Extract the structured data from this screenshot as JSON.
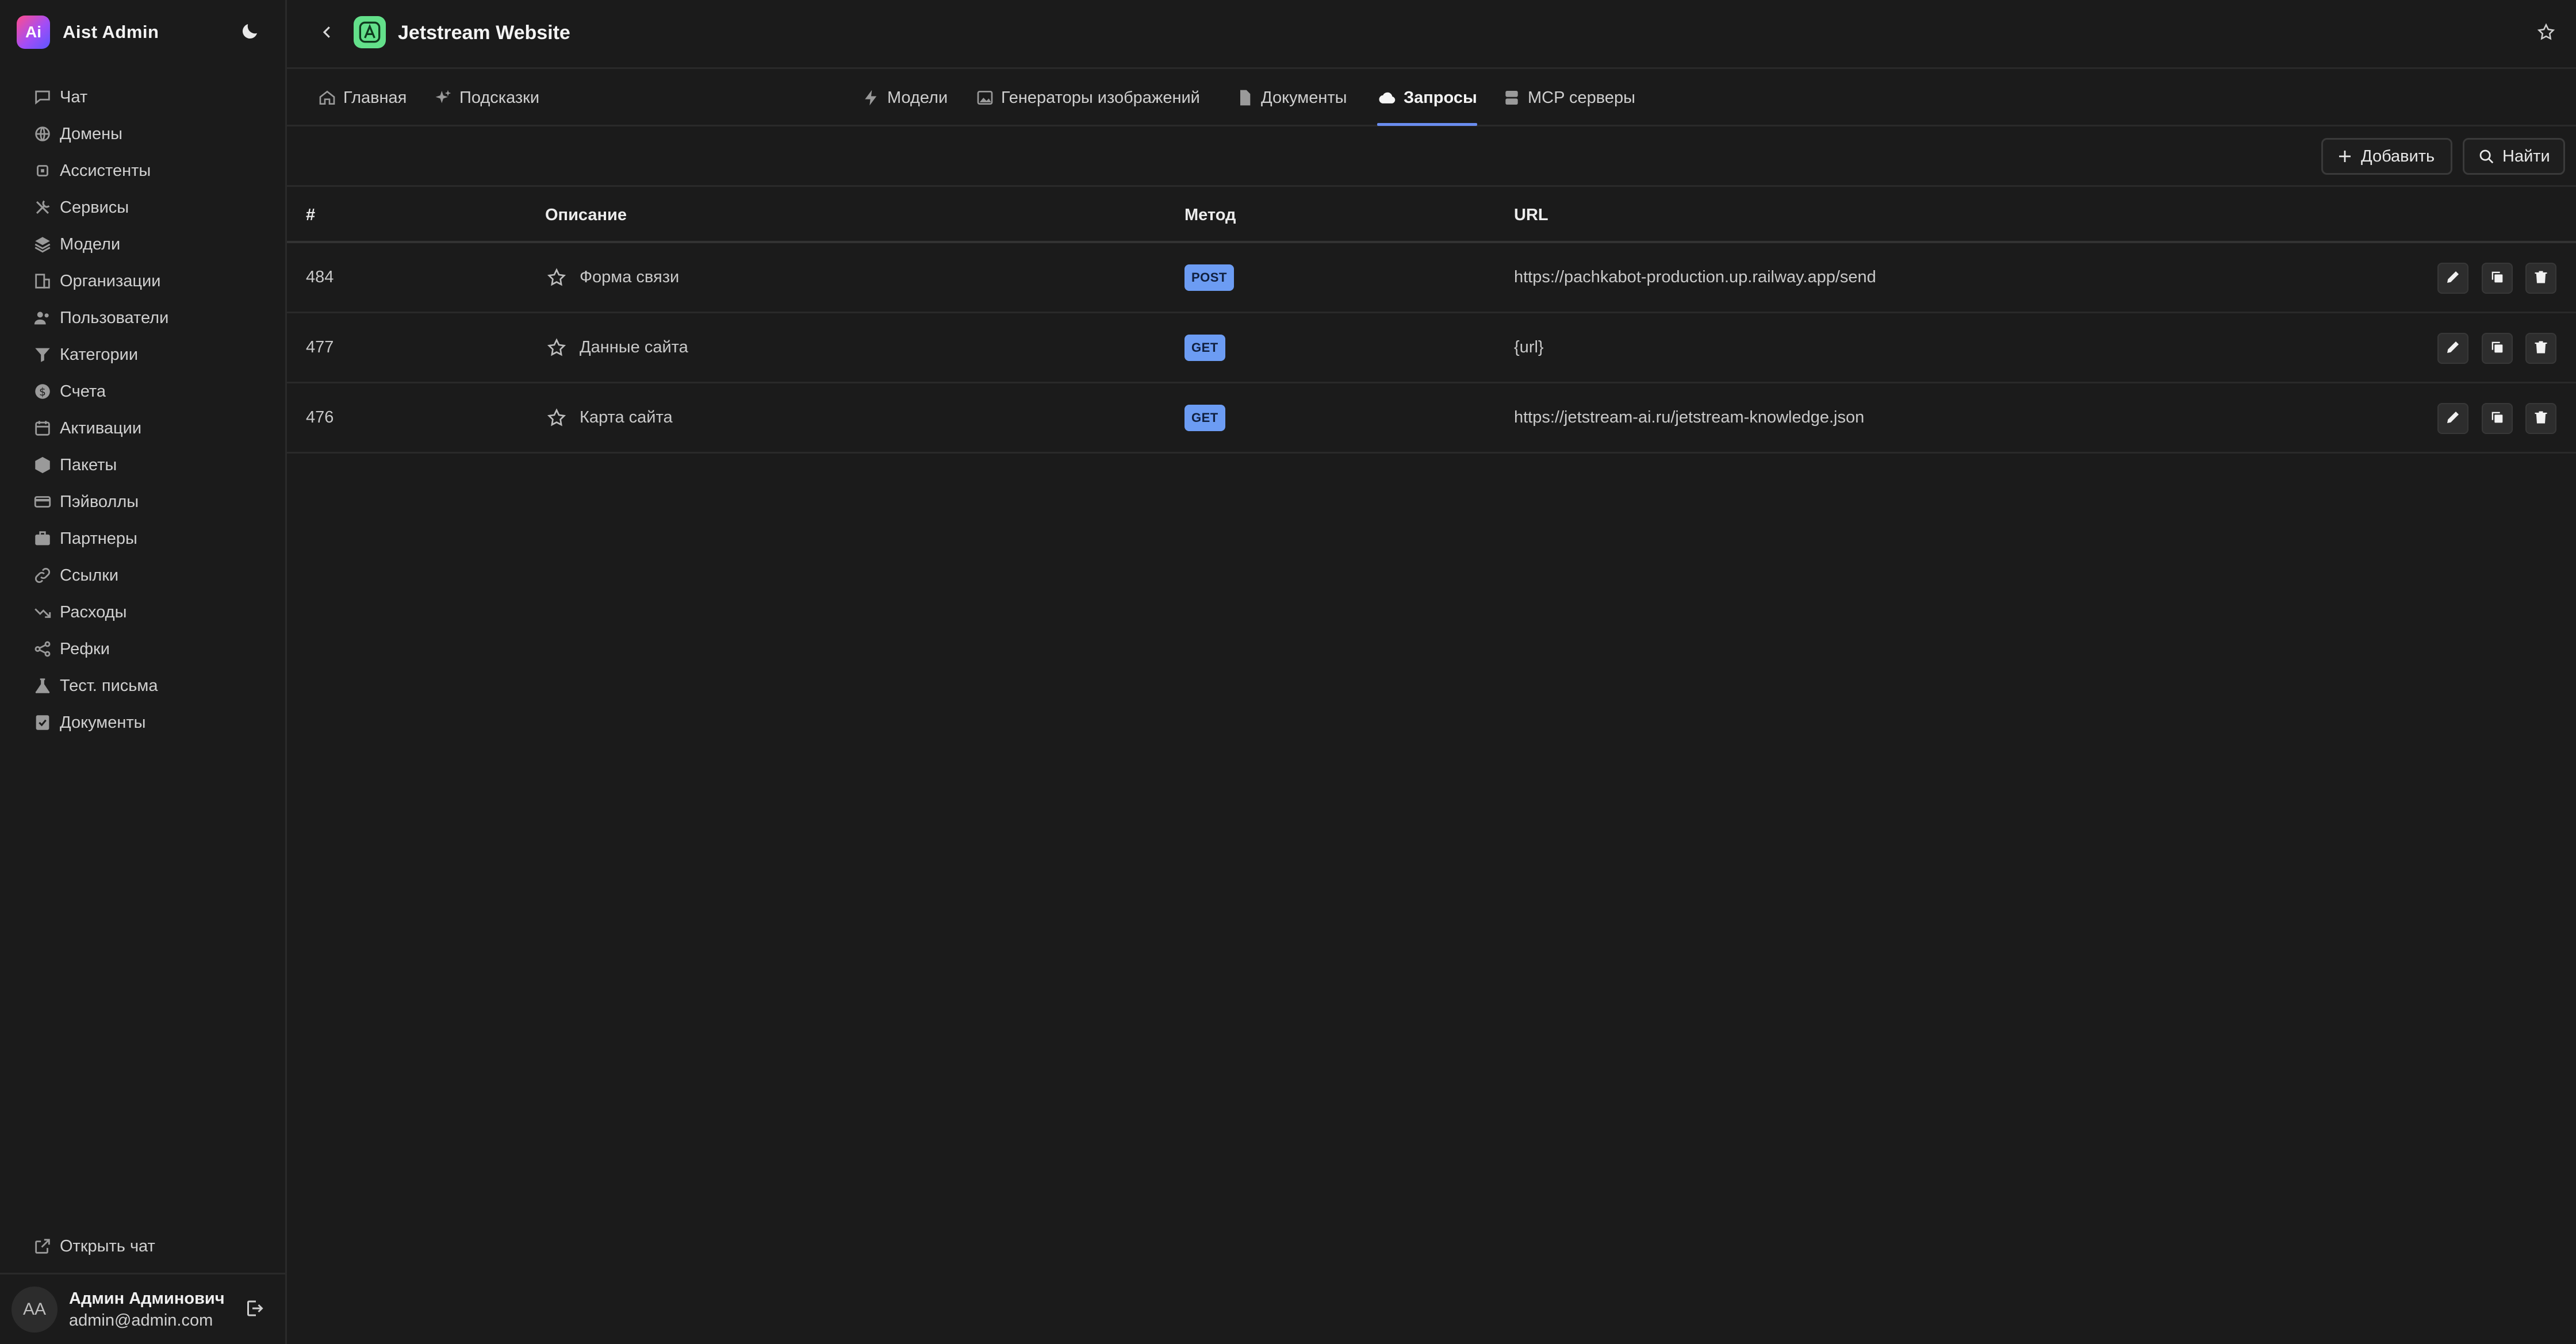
{
  "brand": {
    "logo_text": "Ai",
    "name": "Aist Admin"
  },
  "sidebar": {
    "items": [
      {
        "label": "Чат",
        "icon": "chat-icon"
      },
      {
        "label": "Домены",
        "icon": "globe-icon"
      },
      {
        "label": "Ассистенты",
        "icon": "cpu-icon"
      },
      {
        "label": "Сервисы",
        "icon": "tools-icon"
      },
      {
        "label": "Модели",
        "icon": "layers-icon"
      },
      {
        "label": "Организации",
        "icon": "building-icon"
      },
      {
        "label": "Пользователи",
        "icon": "users-icon"
      },
      {
        "label": "Категории",
        "icon": "filter-icon"
      },
      {
        "label": "Счета",
        "icon": "dollar-icon"
      },
      {
        "label": "Активации",
        "icon": "calendar-icon"
      },
      {
        "label": "Пакеты",
        "icon": "package-icon"
      },
      {
        "label": "Пэйволлы",
        "icon": "card-icon"
      },
      {
        "label": "Партнеры",
        "icon": "briefcase-icon"
      },
      {
        "label": "Ссылки",
        "icon": "link-icon"
      },
      {
        "label": "Расходы",
        "icon": "trend-down-icon"
      },
      {
        "label": "Рефки",
        "icon": "share-icon"
      },
      {
        "label": "Тест. письма",
        "icon": "flask-icon"
      },
      {
        "label": "Документы",
        "icon": "document-check-icon"
      }
    ],
    "open_chat": "Открыть чат",
    "user": {
      "initials": "AA",
      "name": "Админ Админович",
      "email": "admin@admin.com"
    }
  },
  "header": {
    "title": "Jetstream Website"
  },
  "tabs": [
    {
      "label": "Главная",
      "icon": "home-icon",
      "active": false
    },
    {
      "label": "Подсказки",
      "icon": "sparkles-icon",
      "active": false
    },
    {
      "label": "Модели",
      "icon": "bolt-icon",
      "active": false
    },
    {
      "label": "Генераторы изображений",
      "icon": "image-icon",
      "active": false
    },
    {
      "label": "Документы",
      "icon": "file-icon",
      "active": false
    },
    {
      "label": "Запросы",
      "icon": "cloud-icon",
      "active": true
    },
    {
      "label": "MCP серверы",
      "icon": "server-icon",
      "active": false
    }
  ],
  "toolbar": {
    "add_label": "Добавить",
    "search_label": "Найти"
  },
  "table": {
    "columns": [
      "#",
      "Описание",
      "Метод",
      "URL"
    ],
    "rows": [
      {
        "id": "484",
        "description": "Форма связи",
        "method": "POST",
        "url": "https://pachkabot-production.up.railway.app/send"
      },
      {
        "id": "477",
        "description": "Данные сайта",
        "method": "GET",
        "url": "{url}"
      },
      {
        "id": "476",
        "description": "Карта сайта",
        "method": "GET",
        "url": "https://jetstream-ai.ru/jetstream-knowledge.json"
      }
    ]
  },
  "colors": {
    "accent": "#6a8df0",
    "badge": "#6c9cf3",
    "background": "#1b1b1b",
    "project_icon": "#63e08a"
  }
}
